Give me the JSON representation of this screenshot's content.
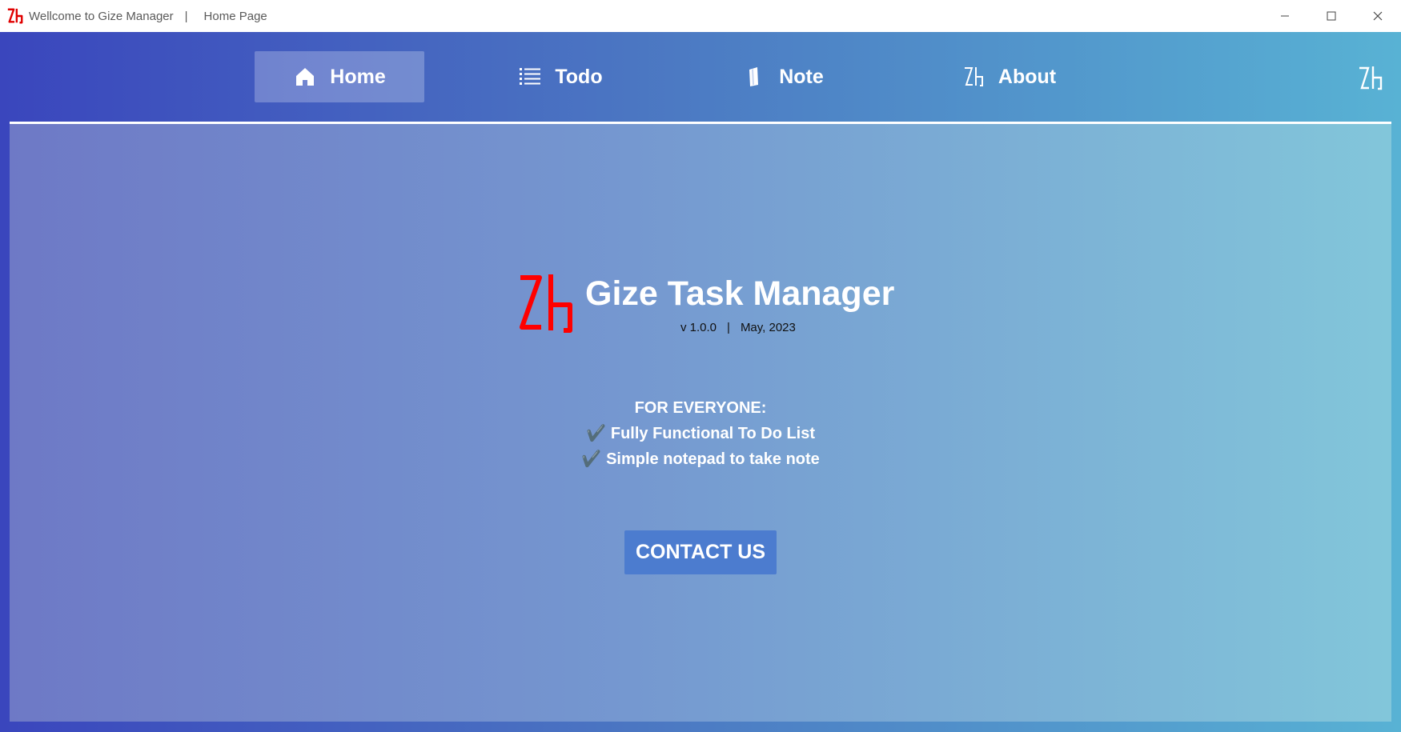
{
  "window": {
    "title": "Wellcome to Gize Manager",
    "separator": "|",
    "page": "Home Page",
    "controls": [
      "minimize-icon",
      "maximize-icon",
      "close-icon"
    ]
  },
  "nav": {
    "items": [
      {
        "label": "Home",
        "icon": "home-icon",
        "active": true
      },
      {
        "label": "Todo",
        "icon": "list-icon",
        "active": false
      },
      {
        "label": "Note",
        "icon": "note-icon",
        "active": false
      },
      {
        "label": "About",
        "icon": "zh-logo-icon",
        "active": false
      }
    ]
  },
  "hero": {
    "title": "Gize Task Manager",
    "version": "v 1.0.0",
    "separator": "|",
    "date": "May, 2023"
  },
  "features": {
    "heading": "FOR EVERYONE:",
    "items": [
      {
        "check": "✔️",
        "text": "Fully Functional To Do List"
      },
      {
        "check": "✔️",
        "text": "Simple notepad to take note"
      }
    ]
  },
  "contact": {
    "label": "CONTACT US"
  },
  "colors": {
    "logo_red": "#ff0000",
    "accent_button": "#4c7ccf",
    "nav_gradient_start": "#3a46bd",
    "nav_gradient_end": "#58b2d4"
  }
}
